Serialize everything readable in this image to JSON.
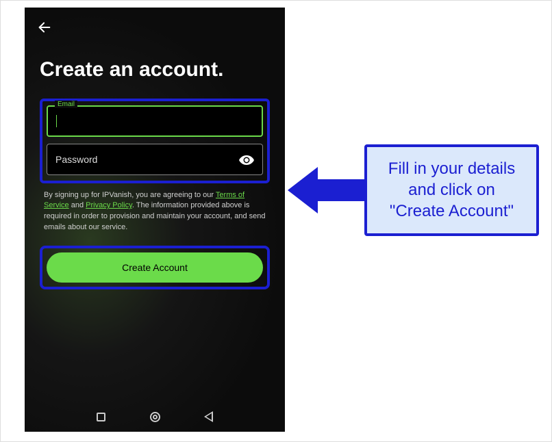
{
  "heading": "Create an account.",
  "form": {
    "email_label": "Email",
    "email_value": "",
    "password_placeholder": "Password",
    "password_value": ""
  },
  "legal": {
    "prefix": "By signing up for IPVanish, you are agreeing to our ",
    "tos": "Terms of Service",
    "and": " and ",
    "privacy": "Privacy Policy",
    "suffix": ". The information provided above is required in order to provision and maintain your account, and send emails about our service."
  },
  "button": {
    "create_account": "Create Account"
  },
  "callout": {
    "text": "Fill in your details and click on \"Create Account\""
  }
}
